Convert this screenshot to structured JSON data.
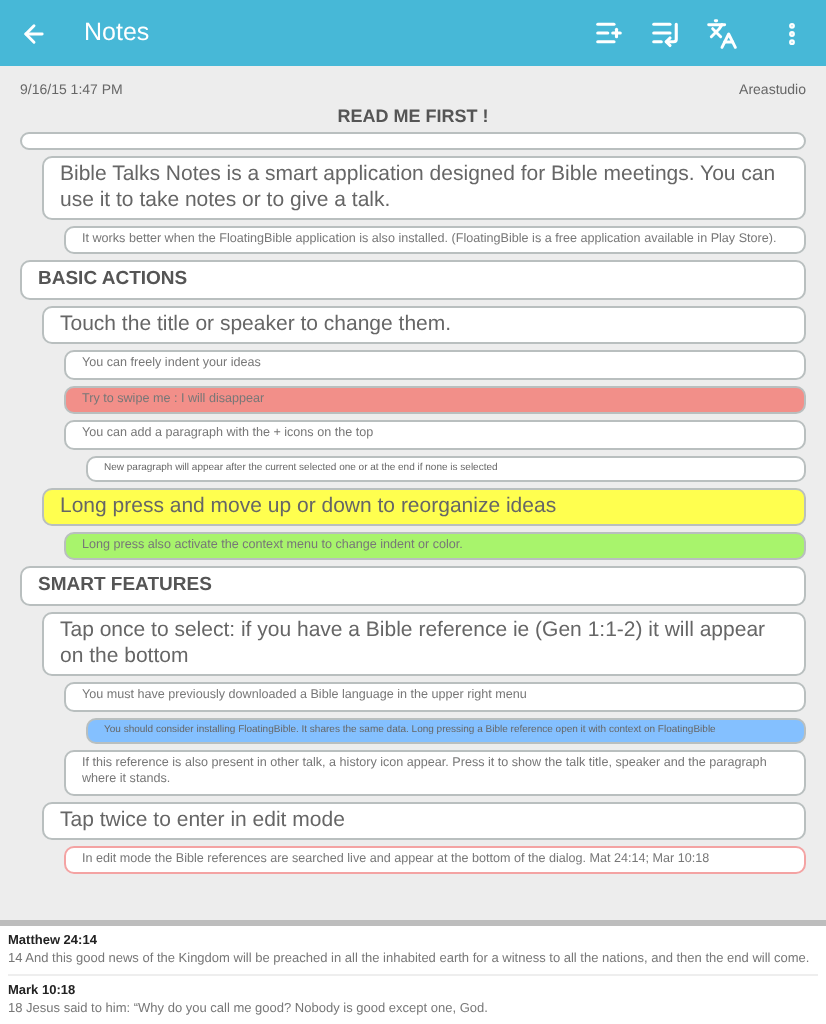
{
  "app_bar": {
    "title": "Notes"
  },
  "talk": {
    "date": "9/16/15 1:47 PM",
    "speaker": "Areastudio",
    "title": "READ ME FIRST !"
  },
  "sections": [
    {
      "selected": false,
      "children": [
        {
          "text": "Bible Talks Notes is a smart application designed for Bible meetings. You can use it to take notes or to give a talk.",
          "selected": false,
          "children": [
            {
              "text": "It works better when the FloatingBible application is also installed. (FloatingBible is a free application available in Play Store).",
              "selected": false
            }
          ]
        }
      ]
    },
    {
      "title": "BASIC ACTIONS",
      "selected": false,
      "children": [
        {
          "text": "Touch the title or speaker to change them.",
          "selected": false,
          "children": [
            {
              "text": "You can freely indent your ideas",
              "selected": false
            },
            {
              "text": "Try to swipe me : I will disappear",
              "color": "#f28f89",
              "selected": false
            },
            {
              "text": "You can add a paragraph with the + icons on the top",
              "selected": false,
              "children": [
                {
                  "text": "New paragraph will appear after the current selected one or at the end if none is selected",
                  "selected": false
                }
              ]
            }
          ]
        },
        {
          "text": "Long press and move up or down to reorganize ideas",
          "color": "#ffff4f",
          "selected": false,
          "children": [
            {
              "text": "Long press also activate the context menu to change indent or color.",
              "color": "#a8f46c",
              "selected": false
            }
          ]
        }
      ]
    },
    {
      "title": "SMART FEATURES",
      "selected": false,
      "children": [
        {
          "text": "Tap once to select: if you have a Bible reference ie (Gen 1:1-2) it will appear on the bottom",
          "selected": false,
          "children": [
            {
              "text": "You must have previously downloaded a Bible language in the upper right menu",
              "selected": false,
              "children": [
                {
                  "text": "You should consider installing FloatingBible.  It shares the same data.  Long pressing a Bible reference open it with context on FloatingBible",
                  "color": "#84c0ff",
                  "selected": false
                }
              ]
            },
            {
              "text": "If this reference is also present in other talk, a history icon appear. Press it to show the talk title, speaker and the paragraph where it stands.",
              "selected": false
            }
          ]
        },
        {
          "text": "Tap twice to enter in edit mode",
          "selected": false,
          "children": [
            {
              "text": "In edit mode the Bible references are searched live and appear at the bottom of the dialog. Mat 24:14; Mar 10:18",
              "selected": true
            }
          ]
        }
      ]
    }
  ],
  "references": [
    {
      "reference": "Matthew 24:14",
      "verse": "14  And this good news of the Kingdom will be preached in all the inhabited earth for a witness to all the nations, and then the end will come."
    },
    {
      "reference": "Mark 10:18",
      "verse": "18  Jesus said to him: “Why do you call me good? Nobody is good except one, God."
    }
  ]
}
